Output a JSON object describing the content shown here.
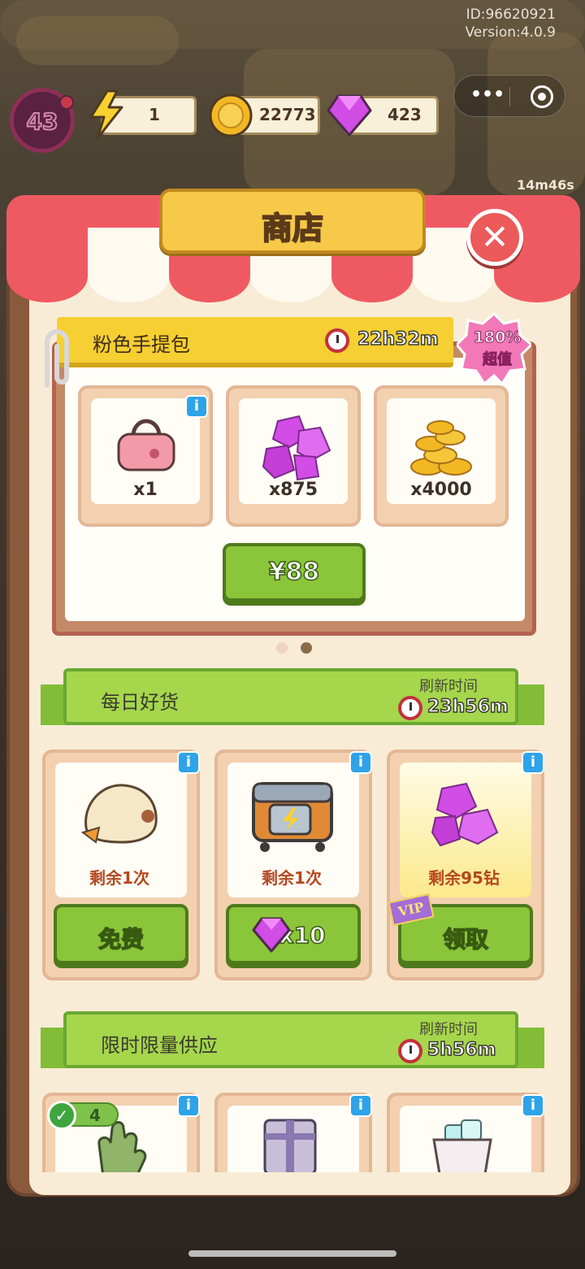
{
  "system": {
    "id_text": "ID:96620921",
    "version_text": "Version:4.0.9",
    "menu_dots": "•••"
  },
  "player": {
    "level": "43"
  },
  "resources": {
    "energy": "1",
    "coins": "22773",
    "gems": "423"
  },
  "background": {
    "timer": "14m46s"
  },
  "shop": {
    "title": "商店",
    "close_symbol": "✕",
    "bundle": {
      "name": "粉色手提包",
      "timer": "22h32m",
      "badge_percent": "180%",
      "badge_text": "超值",
      "items": [
        {
          "icon": "pink-handbag-icon",
          "qty": "x1"
        },
        {
          "icon": "gem-pile-icon",
          "qty": "x875"
        },
        {
          "icon": "coin-pile-icon",
          "qty": "x4000"
        }
      ],
      "price": "¥88",
      "page_indicator": {
        "count": 2,
        "active": 1
      }
    },
    "daily": {
      "title": "每日好货",
      "refresh_label": "刷新时间",
      "timer": "23h56m",
      "items": [
        {
          "icon": "chick-pillow-icon",
          "remaining": "剩余1次",
          "button": "免费"
        },
        {
          "icon": "energy-chest-icon",
          "remaining": "剩余1次",
          "button": "x10"
        },
        {
          "icon": "gem-icon",
          "remaining": "剩余95钻",
          "button": "领取",
          "vip": "VIP"
        }
      ]
    },
    "limited": {
      "title": "限时限量供应",
      "refresh_label": "刷新时间",
      "timer": "5h56m",
      "items": [
        {
          "icon": "garden-glove-icon",
          "owned_badge": "4"
        },
        {
          "icon": "gift-box-icon"
        },
        {
          "icon": "ice-bucket-icon"
        }
      ]
    },
    "info_symbol": "i"
  },
  "colors": {
    "accent_green": "#8ac53a",
    "panel_brown": "#8a5a3c",
    "awning_red": "#ef5a62",
    "gem_purple": "#d24ce6",
    "coin_gold": "#f2b824"
  }
}
